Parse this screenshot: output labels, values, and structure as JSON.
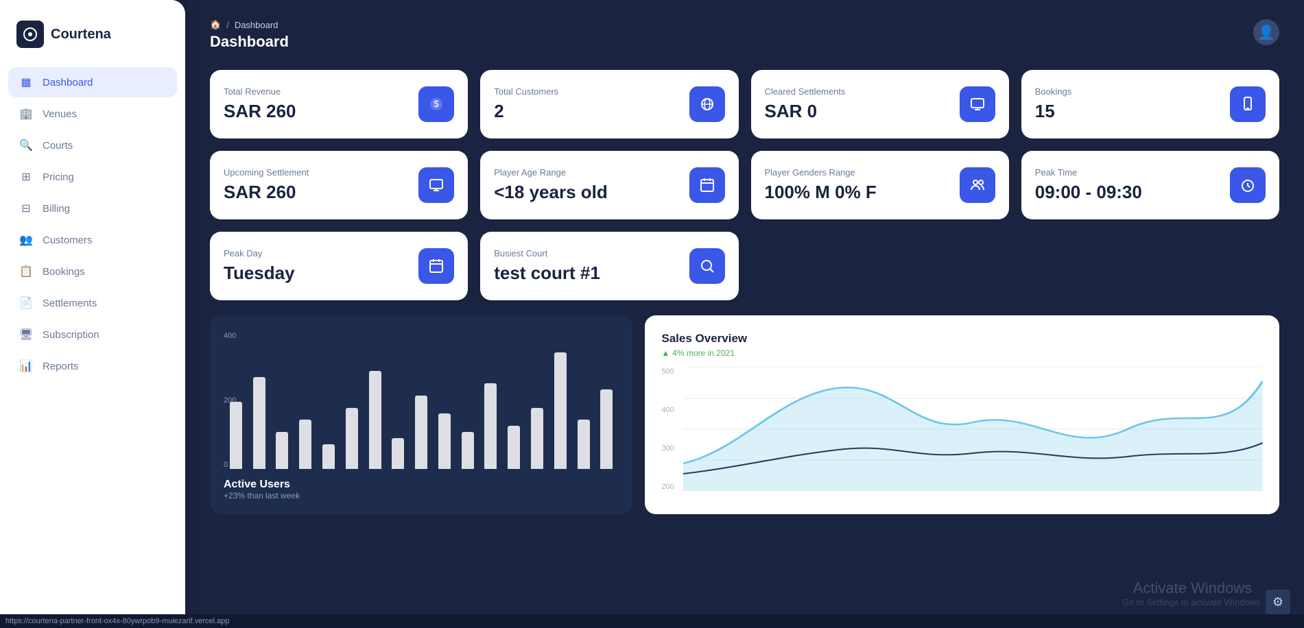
{
  "app": {
    "name": "Courtena",
    "logo_char": "⊙"
  },
  "breadcrumb": {
    "home": "🏠",
    "separator": "/",
    "current": "Dashboard"
  },
  "page": {
    "title": "Dashboard"
  },
  "sidebar": {
    "items": [
      {
        "id": "dashboard",
        "label": "Dashboard",
        "icon": "▦",
        "active": true
      },
      {
        "id": "venues",
        "label": "Venues",
        "icon": "🏢",
        "active": false
      },
      {
        "id": "courts",
        "label": "Courts",
        "icon": "🔍",
        "active": false
      },
      {
        "id": "pricing",
        "label": "Pricing",
        "icon": "⊞",
        "active": false
      },
      {
        "id": "billing",
        "label": "Billing",
        "icon": "⊟",
        "active": false
      },
      {
        "id": "customers",
        "label": "Customers",
        "icon": "👥",
        "active": false
      },
      {
        "id": "bookings",
        "label": "Bookings",
        "icon": "📋",
        "active": false
      },
      {
        "id": "settlements",
        "label": "Settlements",
        "icon": "📄",
        "active": false
      },
      {
        "id": "subscription",
        "label": "Subscription",
        "icon": "🖥",
        "active": false
      },
      {
        "id": "reports",
        "label": "Reports",
        "icon": "📊",
        "active": false
      }
    ]
  },
  "stats_row1": [
    {
      "id": "total-revenue",
      "label": "Total Revenue",
      "value": "SAR 260",
      "icon": "💲"
    },
    {
      "id": "total-customers",
      "label": "Total Customers",
      "value": "2",
      "icon": "🌐"
    },
    {
      "id": "cleared-settlements",
      "label": "Cleared Settlements",
      "value": "SAR 0",
      "icon": "🖥"
    },
    {
      "id": "bookings",
      "label": "Bookings",
      "value": "15",
      "icon": "📱"
    }
  ],
  "stats_row2": [
    {
      "id": "upcoming-settlement",
      "label": "Upcoming Settlement",
      "value": "SAR 260",
      "icon": "🖥"
    },
    {
      "id": "player-age-range",
      "label": "Player Age Range",
      "value": "<18 years old",
      "icon": "📅"
    },
    {
      "id": "player-genders-range",
      "label": "Player Genders Range",
      "value": "100% M 0% F",
      "icon": "👥"
    },
    {
      "id": "peak-time",
      "label": "Peak Time",
      "value": "09:00 - 09:30",
      "icon": "⏰"
    }
  ],
  "stats_row3": [
    {
      "id": "peak-day",
      "label": "Peak Day",
      "value": "Tuesday",
      "icon": "📅"
    },
    {
      "id": "busiest-court",
      "label": "Busiest Court",
      "value": "test court #1",
      "icon": "🔍"
    }
  ],
  "bar_chart": {
    "y_labels": [
      "400",
      "200",
      "0"
    ],
    "bars": [
      55,
      75,
      30,
      40,
      20,
      50,
      80,
      25,
      60,
      45,
      30,
      70,
      35,
      50,
      95,
      40,
      65
    ],
    "title": "Active Users",
    "subtitle": "+23% than last week"
  },
  "sales_overview": {
    "title": "Sales Overview",
    "subtitle": "4% more in 2021",
    "y_labels": [
      "500",
      "400",
      "300",
      "200"
    ],
    "line1_color": "#6ec6ea",
    "line2_color": "#2a3a5e"
  },
  "windows_watermark": {
    "title": "Activate Windows",
    "subtitle": "Go to Settings to activate Windows."
  },
  "statusbar": {
    "url": "https://courtena-partner-front-ox4x-80ywrpob9-muiezarif.vercel.app"
  }
}
